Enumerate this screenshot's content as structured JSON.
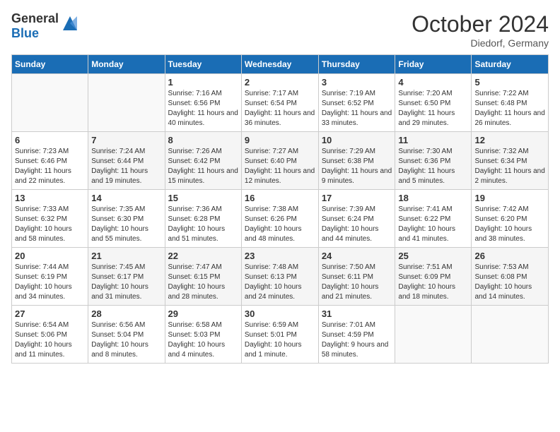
{
  "header": {
    "logo_general": "General",
    "logo_blue": "Blue",
    "month": "October 2024",
    "location": "Diedorf, Germany"
  },
  "weekdays": [
    "Sunday",
    "Monday",
    "Tuesday",
    "Wednesday",
    "Thursday",
    "Friday",
    "Saturday"
  ],
  "weeks": [
    [
      {
        "day": "",
        "sunrise": "",
        "sunset": "",
        "daylight": ""
      },
      {
        "day": "",
        "sunrise": "",
        "sunset": "",
        "daylight": ""
      },
      {
        "day": "1",
        "sunrise": "Sunrise: 7:16 AM",
        "sunset": "Sunset: 6:56 PM",
        "daylight": "Daylight: 11 hours and 40 minutes."
      },
      {
        "day": "2",
        "sunrise": "Sunrise: 7:17 AM",
        "sunset": "Sunset: 6:54 PM",
        "daylight": "Daylight: 11 hours and 36 minutes."
      },
      {
        "day": "3",
        "sunrise": "Sunrise: 7:19 AM",
        "sunset": "Sunset: 6:52 PM",
        "daylight": "Daylight: 11 hours and 33 minutes."
      },
      {
        "day": "4",
        "sunrise": "Sunrise: 7:20 AM",
        "sunset": "Sunset: 6:50 PM",
        "daylight": "Daylight: 11 hours and 29 minutes."
      },
      {
        "day": "5",
        "sunrise": "Sunrise: 7:22 AM",
        "sunset": "Sunset: 6:48 PM",
        "daylight": "Daylight: 11 hours and 26 minutes."
      }
    ],
    [
      {
        "day": "6",
        "sunrise": "Sunrise: 7:23 AM",
        "sunset": "Sunset: 6:46 PM",
        "daylight": "Daylight: 11 hours and 22 minutes."
      },
      {
        "day": "7",
        "sunrise": "Sunrise: 7:24 AM",
        "sunset": "Sunset: 6:44 PM",
        "daylight": "Daylight: 11 hours and 19 minutes."
      },
      {
        "day": "8",
        "sunrise": "Sunrise: 7:26 AM",
        "sunset": "Sunset: 6:42 PM",
        "daylight": "Daylight: 11 hours and 15 minutes."
      },
      {
        "day": "9",
        "sunrise": "Sunrise: 7:27 AM",
        "sunset": "Sunset: 6:40 PM",
        "daylight": "Daylight: 11 hours and 12 minutes."
      },
      {
        "day": "10",
        "sunrise": "Sunrise: 7:29 AM",
        "sunset": "Sunset: 6:38 PM",
        "daylight": "Daylight: 11 hours and 9 minutes."
      },
      {
        "day": "11",
        "sunrise": "Sunrise: 7:30 AM",
        "sunset": "Sunset: 6:36 PM",
        "daylight": "Daylight: 11 hours and 5 minutes."
      },
      {
        "day": "12",
        "sunrise": "Sunrise: 7:32 AM",
        "sunset": "Sunset: 6:34 PM",
        "daylight": "Daylight: 11 hours and 2 minutes."
      }
    ],
    [
      {
        "day": "13",
        "sunrise": "Sunrise: 7:33 AM",
        "sunset": "Sunset: 6:32 PM",
        "daylight": "Daylight: 10 hours and 58 minutes."
      },
      {
        "day": "14",
        "sunrise": "Sunrise: 7:35 AM",
        "sunset": "Sunset: 6:30 PM",
        "daylight": "Daylight: 10 hours and 55 minutes."
      },
      {
        "day": "15",
        "sunrise": "Sunrise: 7:36 AM",
        "sunset": "Sunset: 6:28 PM",
        "daylight": "Daylight: 10 hours and 51 minutes."
      },
      {
        "day": "16",
        "sunrise": "Sunrise: 7:38 AM",
        "sunset": "Sunset: 6:26 PM",
        "daylight": "Daylight: 10 hours and 48 minutes."
      },
      {
        "day": "17",
        "sunrise": "Sunrise: 7:39 AM",
        "sunset": "Sunset: 6:24 PM",
        "daylight": "Daylight: 10 hours and 44 minutes."
      },
      {
        "day": "18",
        "sunrise": "Sunrise: 7:41 AM",
        "sunset": "Sunset: 6:22 PM",
        "daylight": "Daylight: 10 hours and 41 minutes."
      },
      {
        "day": "19",
        "sunrise": "Sunrise: 7:42 AM",
        "sunset": "Sunset: 6:20 PM",
        "daylight": "Daylight: 10 hours and 38 minutes."
      }
    ],
    [
      {
        "day": "20",
        "sunrise": "Sunrise: 7:44 AM",
        "sunset": "Sunset: 6:19 PM",
        "daylight": "Daylight: 10 hours and 34 minutes."
      },
      {
        "day": "21",
        "sunrise": "Sunrise: 7:45 AM",
        "sunset": "Sunset: 6:17 PM",
        "daylight": "Daylight: 10 hours and 31 minutes."
      },
      {
        "day": "22",
        "sunrise": "Sunrise: 7:47 AM",
        "sunset": "Sunset: 6:15 PM",
        "daylight": "Daylight: 10 hours and 28 minutes."
      },
      {
        "day": "23",
        "sunrise": "Sunrise: 7:48 AM",
        "sunset": "Sunset: 6:13 PM",
        "daylight": "Daylight: 10 hours and 24 minutes."
      },
      {
        "day": "24",
        "sunrise": "Sunrise: 7:50 AM",
        "sunset": "Sunset: 6:11 PM",
        "daylight": "Daylight: 10 hours and 21 minutes."
      },
      {
        "day": "25",
        "sunrise": "Sunrise: 7:51 AM",
        "sunset": "Sunset: 6:09 PM",
        "daylight": "Daylight: 10 hours and 18 minutes."
      },
      {
        "day": "26",
        "sunrise": "Sunrise: 7:53 AM",
        "sunset": "Sunset: 6:08 PM",
        "daylight": "Daylight: 10 hours and 14 minutes."
      }
    ],
    [
      {
        "day": "27",
        "sunrise": "Sunrise: 6:54 AM",
        "sunset": "Sunset: 5:06 PM",
        "daylight": "Daylight: 10 hours and 11 minutes."
      },
      {
        "day": "28",
        "sunrise": "Sunrise: 6:56 AM",
        "sunset": "Sunset: 5:04 PM",
        "daylight": "Daylight: 10 hours and 8 minutes."
      },
      {
        "day": "29",
        "sunrise": "Sunrise: 6:58 AM",
        "sunset": "Sunset: 5:03 PM",
        "daylight": "Daylight: 10 hours and 4 minutes."
      },
      {
        "day": "30",
        "sunrise": "Sunrise: 6:59 AM",
        "sunset": "Sunset: 5:01 PM",
        "daylight": "Daylight: 10 hours and 1 minute."
      },
      {
        "day": "31",
        "sunrise": "Sunrise: 7:01 AM",
        "sunset": "Sunset: 4:59 PM",
        "daylight": "Daylight: 9 hours and 58 minutes."
      },
      {
        "day": "",
        "sunrise": "",
        "sunset": "",
        "daylight": ""
      },
      {
        "day": "",
        "sunrise": "",
        "sunset": "",
        "daylight": ""
      }
    ]
  ]
}
